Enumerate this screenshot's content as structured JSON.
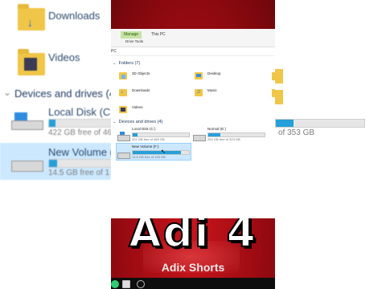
{
  "background_zoom": {
    "folders": [
      {
        "label": "Downloads",
        "icon": "download-folder-icon"
      },
      {
        "label": "Videos",
        "icon": "videos-folder-icon"
      }
    ],
    "section_label": "Devices and drives (4",
    "drives": [
      {
        "name": "Local Disk (C:)",
        "sub": "422 GB free of 46",
        "icon": "system-drive-icon",
        "used": 0.08
      },
      {
        "name": "New Volume (F:)",
        "sub": "14.5 GB free of 1",
        "icon": "drive-icon",
        "used": 0.1
      }
    ],
    "right_sub": "of 353 GB"
  },
  "explorer": {
    "ribbon": {
      "tabs": [
        {
          "label": "Manage",
          "active": true
        },
        {
          "label": "This PC",
          "active": false
        }
      ],
      "command": "Drive Tools"
    },
    "address": "PC",
    "folders_group": "Folders (7)",
    "folders": [
      {
        "label": "3D Objects",
        "icon": "3d-objects-folder-icon"
      },
      {
        "label": "Desktop",
        "icon": "desktop-folder-icon"
      },
      {
        "label": "Downloads",
        "icon": "downloads-folder-icon"
      },
      {
        "label": "Music",
        "icon": "music-folder-icon"
      },
      {
        "label": "Videos",
        "icon": "videos-folder-icon"
      }
    ],
    "drives_group": "Devices and drives (4)",
    "drives": [
      {
        "name": "Local Disk (C:)",
        "sub": "422 GB free of 465 GB",
        "used": 0.09,
        "icon": "system-drive-icon"
      },
      {
        "name": "Normal (E:)",
        "sub": "254 GB free of 323 GB",
        "used": 0.21,
        "icon": "drive-icon"
      },
      {
        "name": "New Volume (F:)",
        "sub": "14.5 GB free of 100 GB",
        "used": 0.86,
        "icon": "drive-icon",
        "selected": true
      }
    ]
  },
  "overlay": {
    "big_text": "Adi 4",
    "watermark": "Adix Shorts"
  },
  "colors": {
    "accent": "#26a0da",
    "red": "#b3101a",
    "manage_tab": "#c7e3a3"
  }
}
